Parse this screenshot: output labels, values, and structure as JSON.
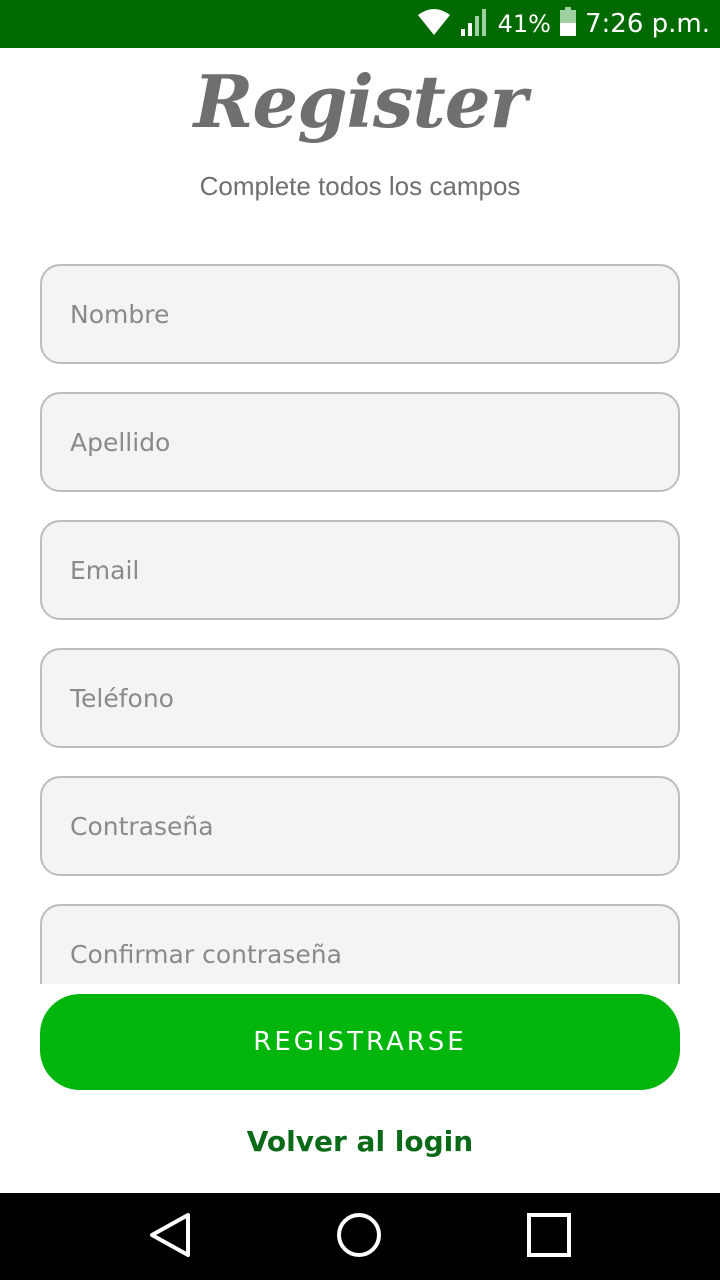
{
  "status_bar": {
    "battery": "41%",
    "time": "7:26 p.m.",
    "icons": [
      "wifi-icon",
      "signal-icon",
      "battery-icon"
    ]
  },
  "header": {
    "title": "Register",
    "subtitle": "Complete todos los campos"
  },
  "form": {
    "fields": [
      {
        "placeholder": "Nombre",
        "value": ""
      },
      {
        "placeholder": "Apellido",
        "value": ""
      },
      {
        "placeholder": "Email",
        "value": ""
      },
      {
        "placeholder": "Teléfono",
        "value": ""
      },
      {
        "placeholder": "Contraseña",
        "value": ""
      },
      {
        "placeholder": "Confirmar contraseña",
        "value": ""
      }
    ],
    "submit_label": "REGISTRARSE",
    "back_link": "Volver al login"
  },
  "nav_bar": {
    "buttons": [
      "back-icon",
      "home-icon",
      "recents-icon"
    ]
  },
  "colors": {
    "status_bar": "#006a00",
    "accent": "#00b60c",
    "link": "#0b6a17",
    "field_bg": "#f4f4f4",
    "field_border": "#bdbdbd"
  }
}
